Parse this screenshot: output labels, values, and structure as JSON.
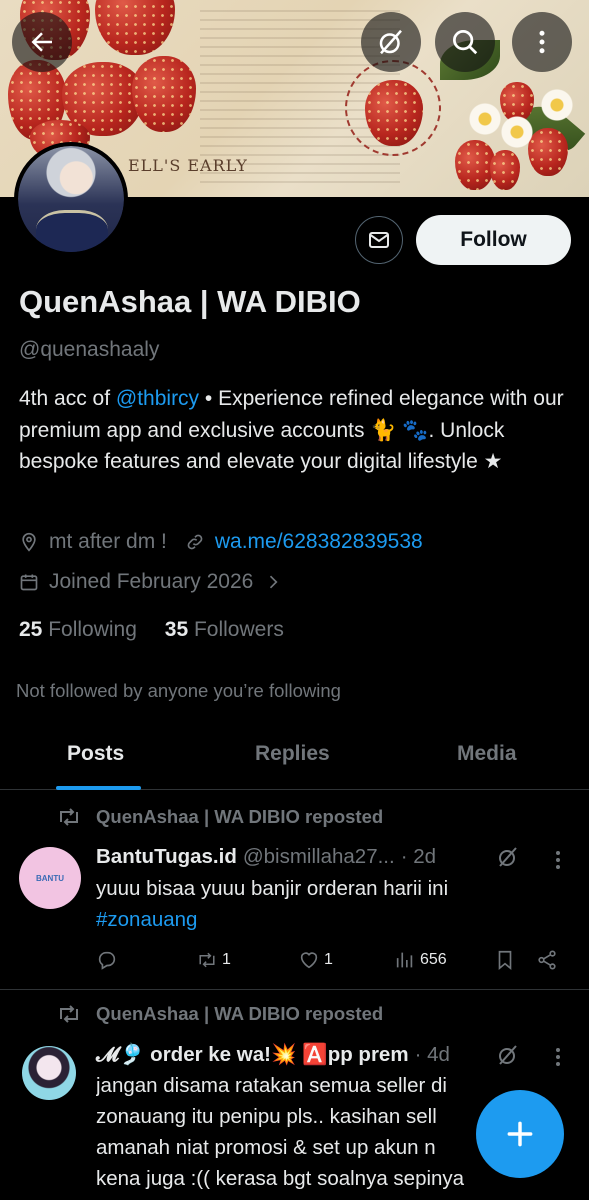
{
  "header": {
    "back_icon": "arrow-left-icon",
    "grok_icon": "grok-icon",
    "search_icon": "search-icon",
    "more_icon": "more-vertical-icon",
    "banner_text": "ELL'S EARLY"
  },
  "profile": {
    "name": "QuenAshaa | WA DIBIO",
    "handle": "@quenashaaly",
    "follow_label": "Follow",
    "bio_prefix": "4th acc of ",
    "bio_mention": "@thbircy",
    "bio_rest": " • Experience refined elegance with our premium app and exclusive accounts 🐈 🐾. Unlock bespoke features and elevate your digital lifestyle ★",
    "location": "mt after dm !",
    "website": "wa.me/628382839538",
    "joined": "Joined February 2026",
    "following_count": "25",
    "following_label": "Following",
    "followers_count": "35",
    "followers_label": "Followers",
    "not_followed": "Not followed by anyone you’re following"
  },
  "tabs": [
    {
      "label": "Posts",
      "active": true
    },
    {
      "label": "Replies",
      "active": false
    },
    {
      "label": "Media",
      "active": false
    }
  ],
  "posts": [
    {
      "repost_by": "QuenAshaa | WA DIBIO reposted",
      "name": "BantuTugas.id",
      "handle": "@bismillaha27...",
      "time": "· 2d",
      "text": "yuuu bisaa yuuu banjir orderan harii ini",
      "hashtag": "#zonauang",
      "reposts": "1",
      "likes": "1",
      "views": "656",
      "avatar_text": "BANTU"
    },
    {
      "repost_by": "QuenAshaa | WA DIBIO reposted",
      "name": "𝓜🎐 order ke wa!💥 🅰️pp prem",
      "time": "· 4d",
      "text_lines": [
        "jangan disama ratakan semua seller di",
        "zonauang itu penipu pls.. kasihan sell",
        "amanah niat promosi & set up akun n",
        "kena juga :(( kerasa bgt soalnya sepinya"
      ]
    }
  ],
  "colors": {
    "accent": "#1d9bf0",
    "background": "#000000",
    "secondary_text": "#71767b"
  }
}
